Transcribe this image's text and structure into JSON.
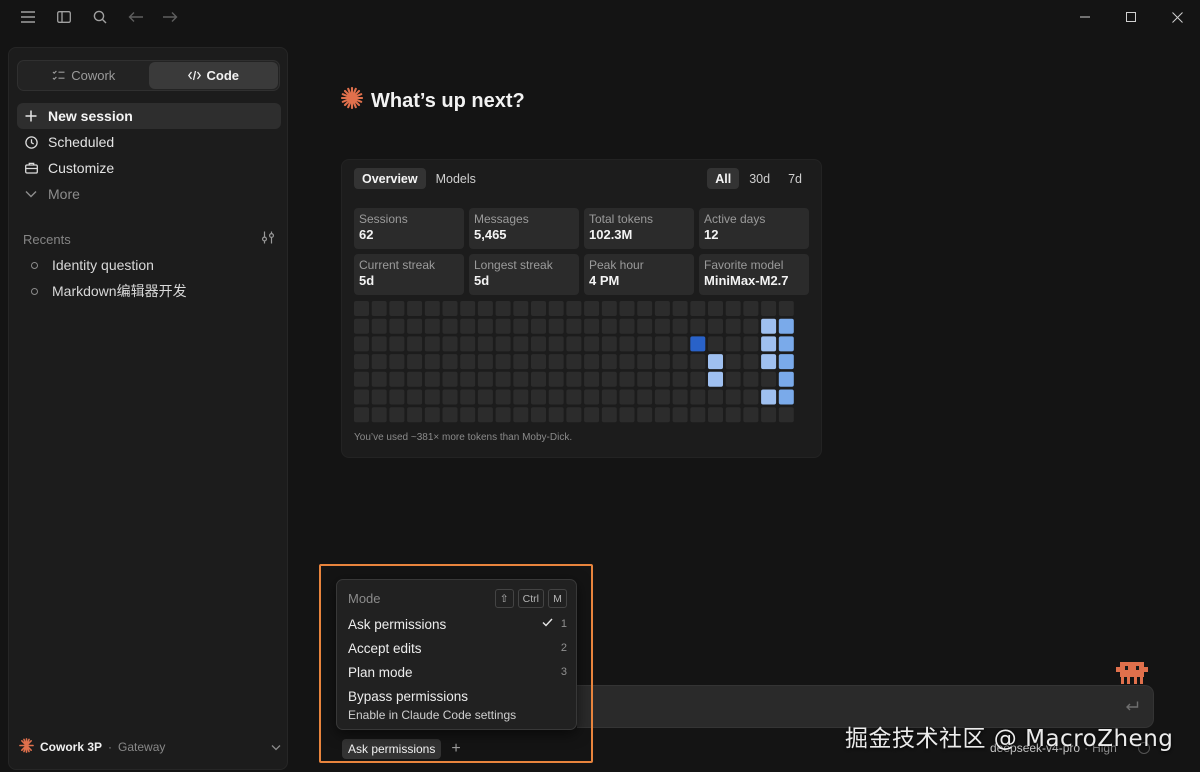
{
  "sidebar": {
    "mode_tabs": [
      {
        "label": "Cowork",
        "icon": "checklist-icon",
        "active": false
      },
      {
        "label": "Code",
        "icon": "code-icon",
        "active": true
      }
    ],
    "nav": [
      {
        "label": "New session",
        "icon": "plus-icon",
        "active": true
      },
      {
        "label": "Scheduled",
        "icon": "clock-icon"
      },
      {
        "label": "Customize",
        "icon": "briefcase-icon"
      },
      {
        "label": "More",
        "icon": "chevron-down-icon"
      }
    ],
    "recents_label": "Recents",
    "recents": [
      "Identity question",
      "Markdown编辑器开发"
    ],
    "account": {
      "name": "Cowork 3P",
      "separator": "·",
      "sub": "Gateway"
    }
  },
  "main": {
    "greeting": "What’s up next?",
    "brand_color": "#e0704c",
    "stats": {
      "tabs": [
        {
          "label": "Overview",
          "active": true
        },
        {
          "label": "Models",
          "active": false
        }
      ],
      "ranges": [
        {
          "label": "All",
          "active": true
        },
        {
          "label": "30d",
          "active": false
        },
        {
          "label": "7d",
          "active": false
        }
      ],
      "cards": [
        {
          "label": "Sessions",
          "value": "62"
        },
        {
          "label": "Messages",
          "value": "5,465"
        },
        {
          "label": "Total tokens",
          "value": "102.3M"
        },
        {
          "label": "Active days",
          "value": "12"
        },
        {
          "label": "Current streak",
          "value": "5d"
        },
        {
          "label": "Longest streak",
          "value": "5d"
        },
        {
          "label": "Peak hour",
          "value": "4 PM"
        },
        {
          "label": "Favorite model",
          "value": "MiniMax-M2.7"
        }
      ],
      "heatmap": {
        "weeks": 25,
        "days": 7,
        "empty_color": "#2c2c2c",
        "colors": {
          "1": "#9fc0f0",
          "2": "#7aaaea",
          "3": "#2962c9"
        },
        "active": [
          {
            "w": 19,
            "d": 2,
            "level": 3
          },
          {
            "w": 20,
            "d": 3,
            "level": 1
          },
          {
            "w": 20,
            "d": 4,
            "level": 1
          },
          {
            "w": 23,
            "d": 1,
            "level": 1
          },
          {
            "w": 23,
            "d": 2,
            "level": 1
          },
          {
            "w": 23,
            "d": 3,
            "level": 1
          },
          {
            "w": 23,
            "d": 5,
            "level": 1
          },
          {
            "w": 24,
            "d": 1,
            "level": 2
          },
          {
            "w": 24,
            "d": 2,
            "level": 2
          },
          {
            "w": 24,
            "d": 3,
            "level": 2
          },
          {
            "w": 24,
            "d": 4,
            "level": 2
          },
          {
            "w": 24,
            "d": 5,
            "level": 2
          }
        ]
      },
      "caption": "You’ve used ~381× more tokens than Moby-Dick."
    }
  },
  "mode_menu": {
    "title": "Mode",
    "shortcut_keys": [
      "⇧",
      "Ctrl",
      "M"
    ],
    "items": [
      {
        "label": "Ask permissions",
        "shortcut": "1",
        "checked": true
      },
      {
        "label": "Accept edits",
        "shortcut": "2"
      },
      {
        "label": "Plan mode",
        "shortcut": "3"
      },
      {
        "label": "Bypass permissions",
        "shortcut": ""
      }
    ],
    "bypass_note": "Enable in Claude Code settings"
  },
  "composer": {
    "permission_label": "Ask permissions",
    "add_label": "+",
    "model": "deepseek-v4-pro",
    "separator": "·",
    "effort": "High"
  },
  "watermark": "掘金技术社区 @ MacroZheng"
}
